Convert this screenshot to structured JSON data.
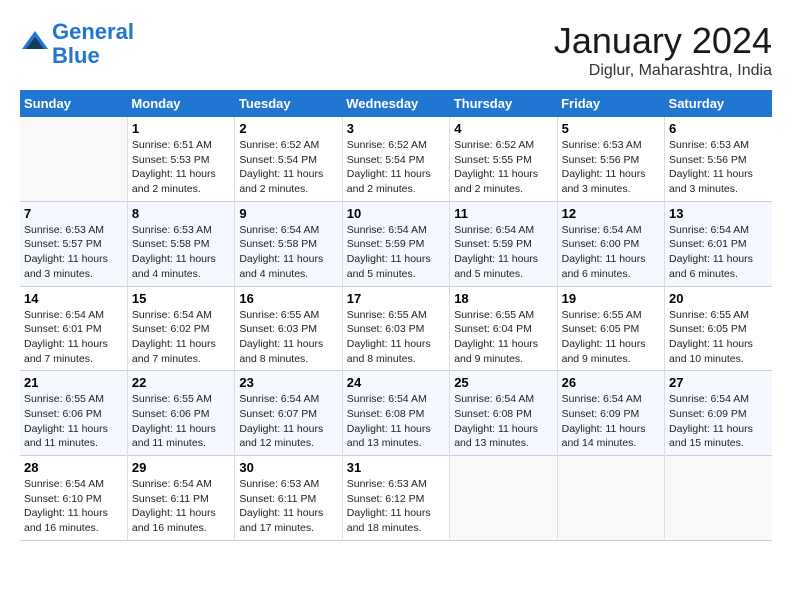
{
  "header": {
    "logo_line1": "General",
    "logo_line2": "Blue",
    "month_title": "January 2024",
    "location": "Diglur, Maharashtra, India"
  },
  "days_of_week": [
    "Sunday",
    "Monday",
    "Tuesday",
    "Wednesday",
    "Thursday",
    "Friday",
    "Saturday"
  ],
  "weeks": [
    [
      {
        "day": "",
        "info": ""
      },
      {
        "day": "1",
        "info": "Sunrise: 6:51 AM\nSunset: 5:53 PM\nDaylight: 11 hours\nand 2 minutes."
      },
      {
        "day": "2",
        "info": "Sunrise: 6:52 AM\nSunset: 5:54 PM\nDaylight: 11 hours\nand 2 minutes."
      },
      {
        "day": "3",
        "info": "Sunrise: 6:52 AM\nSunset: 5:54 PM\nDaylight: 11 hours\nand 2 minutes."
      },
      {
        "day": "4",
        "info": "Sunrise: 6:52 AM\nSunset: 5:55 PM\nDaylight: 11 hours\nand 2 minutes."
      },
      {
        "day": "5",
        "info": "Sunrise: 6:53 AM\nSunset: 5:56 PM\nDaylight: 11 hours\nand 3 minutes."
      },
      {
        "day": "6",
        "info": "Sunrise: 6:53 AM\nSunset: 5:56 PM\nDaylight: 11 hours\nand 3 minutes."
      }
    ],
    [
      {
        "day": "7",
        "info": "Sunrise: 6:53 AM\nSunset: 5:57 PM\nDaylight: 11 hours\nand 3 minutes."
      },
      {
        "day": "8",
        "info": "Sunrise: 6:53 AM\nSunset: 5:58 PM\nDaylight: 11 hours\nand 4 minutes."
      },
      {
        "day": "9",
        "info": "Sunrise: 6:54 AM\nSunset: 5:58 PM\nDaylight: 11 hours\nand 4 minutes."
      },
      {
        "day": "10",
        "info": "Sunrise: 6:54 AM\nSunset: 5:59 PM\nDaylight: 11 hours\nand 5 minutes."
      },
      {
        "day": "11",
        "info": "Sunrise: 6:54 AM\nSunset: 5:59 PM\nDaylight: 11 hours\nand 5 minutes."
      },
      {
        "day": "12",
        "info": "Sunrise: 6:54 AM\nSunset: 6:00 PM\nDaylight: 11 hours\nand 6 minutes."
      },
      {
        "day": "13",
        "info": "Sunrise: 6:54 AM\nSunset: 6:01 PM\nDaylight: 11 hours\nand 6 minutes."
      }
    ],
    [
      {
        "day": "14",
        "info": "Sunrise: 6:54 AM\nSunset: 6:01 PM\nDaylight: 11 hours\nand 7 minutes."
      },
      {
        "day": "15",
        "info": "Sunrise: 6:54 AM\nSunset: 6:02 PM\nDaylight: 11 hours\nand 7 minutes."
      },
      {
        "day": "16",
        "info": "Sunrise: 6:55 AM\nSunset: 6:03 PM\nDaylight: 11 hours\nand 8 minutes."
      },
      {
        "day": "17",
        "info": "Sunrise: 6:55 AM\nSunset: 6:03 PM\nDaylight: 11 hours\nand 8 minutes."
      },
      {
        "day": "18",
        "info": "Sunrise: 6:55 AM\nSunset: 6:04 PM\nDaylight: 11 hours\nand 9 minutes."
      },
      {
        "day": "19",
        "info": "Sunrise: 6:55 AM\nSunset: 6:05 PM\nDaylight: 11 hours\nand 9 minutes."
      },
      {
        "day": "20",
        "info": "Sunrise: 6:55 AM\nSunset: 6:05 PM\nDaylight: 11 hours\nand 10 minutes."
      }
    ],
    [
      {
        "day": "21",
        "info": "Sunrise: 6:55 AM\nSunset: 6:06 PM\nDaylight: 11 hours\nand 11 minutes."
      },
      {
        "day": "22",
        "info": "Sunrise: 6:55 AM\nSunset: 6:06 PM\nDaylight: 11 hours\nand 11 minutes."
      },
      {
        "day": "23",
        "info": "Sunrise: 6:54 AM\nSunset: 6:07 PM\nDaylight: 11 hours\nand 12 minutes."
      },
      {
        "day": "24",
        "info": "Sunrise: 6:54 AM\nSunset: 6:08 PM\nDaylight: 11 hours\nand 13 minutes."
      },
      {
        "day": "25",
        "info": "Sunrise: 6:54 AM\nSunset: 6:08 PM\nDaylight: 11 hours\nand 13 minutes."
      },
      {
        "day": "26",
        "info": "Sunrise: 6:54 AM\nSunset: 6:09 PM\nDaylight: 11 hours\nand 14 minutes."
      },
      {
        "day": "27",
        "info": "Sunrise: 6:54 AM\nSunset: 6:09 PM\nDaylight: 11 hours\nand 15 minutes."
      }
    ],
    [
      {
        "day": "28",
        "info": "Sunrise: 6:54 AM\nSunset: 6:10 PM\nDaylight: 11 hours\nand 16 minutes."
      },
      {
        "day": "29",
        "info": "Sunrise: 6:54 AM\nSunset: 6:11 PM\nDaylight: 11 hours\nand 16 minutes."
      },
      {
        "day": "30",
        "info": "Sunrise: 6:53 AM\nSunset: 6:11 PM\nDaylight: 11 hours\nand 17 minutes."
      },
      {
        "day": "31",
        "info": "Sunrise: 6:53 AM\nSunset: 6:12 PM\nDaylight: 11 hours\nand 18 minutes."
      },
      {
        "day": "",
        "info": ""
      },
      {
        "day": "",
        "info": ""
      },
      {
        "day": "",
        "info": ""
      }
    ]
  ]
}
